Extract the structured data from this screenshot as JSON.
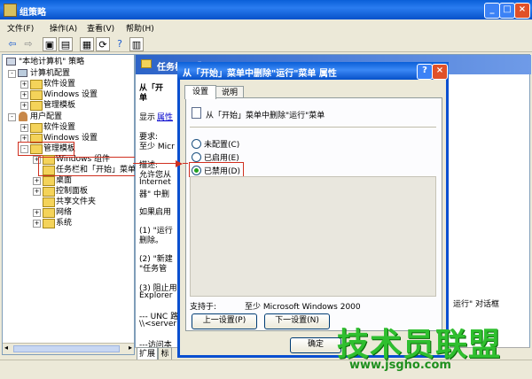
{
  "window": {
    "title": "组策略"
  },
  "menu": [
    "文件(F)",
    "操作(A)",
    "查看(V)",
    "帮助(H)"
  ],
  "toolbar_icons": [
    "back-icon",
    "forward-icon",
    "up-folder-icon",
    "show-tree-icon",
    "properties-icon",
    "refresh-icon",
    "help-icon",
    "export-icon"
  ],
  "tree": {
    "root": "\"本地计算机\" 策略",
    "computer_config": "计算机配置",
    "software_settings": "软件设置",
    "windows_settings": "Windows 设置",
    "admin_templates": "管理模板",
    "user_config": "用户配置",
    "u_software_settings": "软件设置",
    "u_windows_settings": "Windows 设置",
    "u_admin_templates": "管理模板",
    "windows_components": "Windows 组件",
    "taskbar_start": "任务栏和「开始」菜单",
    "desktop": "桌面",
    "control_panel": "控制面板",
    "shared_folders": "共享文件夹",
    "network": "网络",
    "system": "系统"
  },
  "right": {
    "header": "任务栏和「开始」菜单",
    "setting_title": "从「开",
    "setting_title2": "单",
    "display": "显示",
    "properties_link": "属性",
    "requirements": "要求:",
    "req_value": "至少 Micr",
    "desc_label": "描述:",
    "desc1": "允许您从",
    "desc2": "Internet",
    "desc3": "器\" 中删",
    "if_enabled": "如果启用",
    "p1a": "(1) \"运行",
    "p1b": "删除。",
    "p2a": "(2) \"新建",
    "p2b": "\"任务管",
    "p3a": "(3) 阻止用",
    "p3b": "Explorer",
    "unc": "--- UNC 路",
    "server": "\\\\<server",
    "access": "---访问本",
    "run_dialog": "运行\" 对话框",
    "tab_extended": "扩展",
    "tab_standard": "标"
  },
  "dialog": {
    "title": "从「开始」菜单中删除\"运行\"菜单 属性",
    "tab_settings": "设置",
    "tab_explain": "说明",
    "policy_name": "从「开始」菜单中删除\"运行\"菜单",
    "opt_not_configured": "未配置(C)",
    "opt_enabled": "已启用(E)",
    "opt_disabled": "已禁用(D)",
    "supported_label": "支持于:",
    "supported_value": "至少 Microsoft Windows 2000",
    "prev_button": "上一设置(P)",
    "next_button": "下一设置(N)",
    "ok_button": "确定"
  },
  "watermark": {
    "cn": "技术员联盟",
    "url": "www.jsgho.com"
  },
  "colors": {
    "titlebar": "#0a5fd8",
    "highlight": "#d03020",
    "watermark": "#2fbf2f"
  }
}
